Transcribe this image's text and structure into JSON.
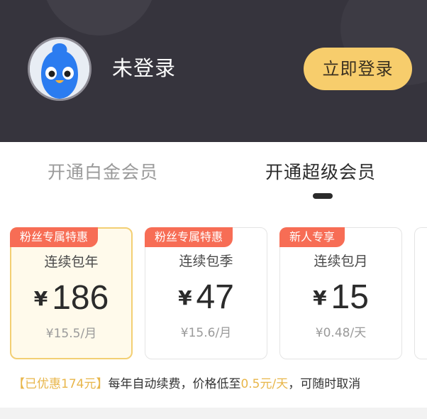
{
  "header": {
    "username": "未登录",
    "login_button": "立即登录",
    "avatar_icon": "bird-mascot-icon"
  },
  "tabs": [
    {
      "label": "开通白金会员",
      "active": false
    },
    {
      "label": "开通超级会员",
      "active": true
    }
  ],
  "plans": [
    {
      "badge": "粉丝专属特惠",
      "name": "连续包年",
      "currency": "¥",
      "price": "186",
      "unit_price": "¥15.5/月",
      "selected": true
    },
    {
      "badge": "粉丝专属特惠",
      "name": "连续包季",
      "currency": "¥",
      "price": "47",
      "unit_price": "¥15.6/月",
      "selected": false
    },
    {
      "badge": "新人专享",
      "name": "连续包月",
      "currency": "¥",
      "price": "15",
      "unit_price": "¥0.48/天",
      "selected": false
    }
  ],
  "note": {
    "discount": "【已优惠174元】",
    "text_a": "每年自动续费，价格低至",
    "highlight_price": "0.5元/天",
    "text_b": "，可随时取消"
  },
  "colors": {
    "header_bg": "#36343d",
    "login_button": "#f7cd6c",
    "badge": "#f76d55",
    "selected_border": "#f3cf73",
    "highlight_text": "#e8b64a"
  }
}
